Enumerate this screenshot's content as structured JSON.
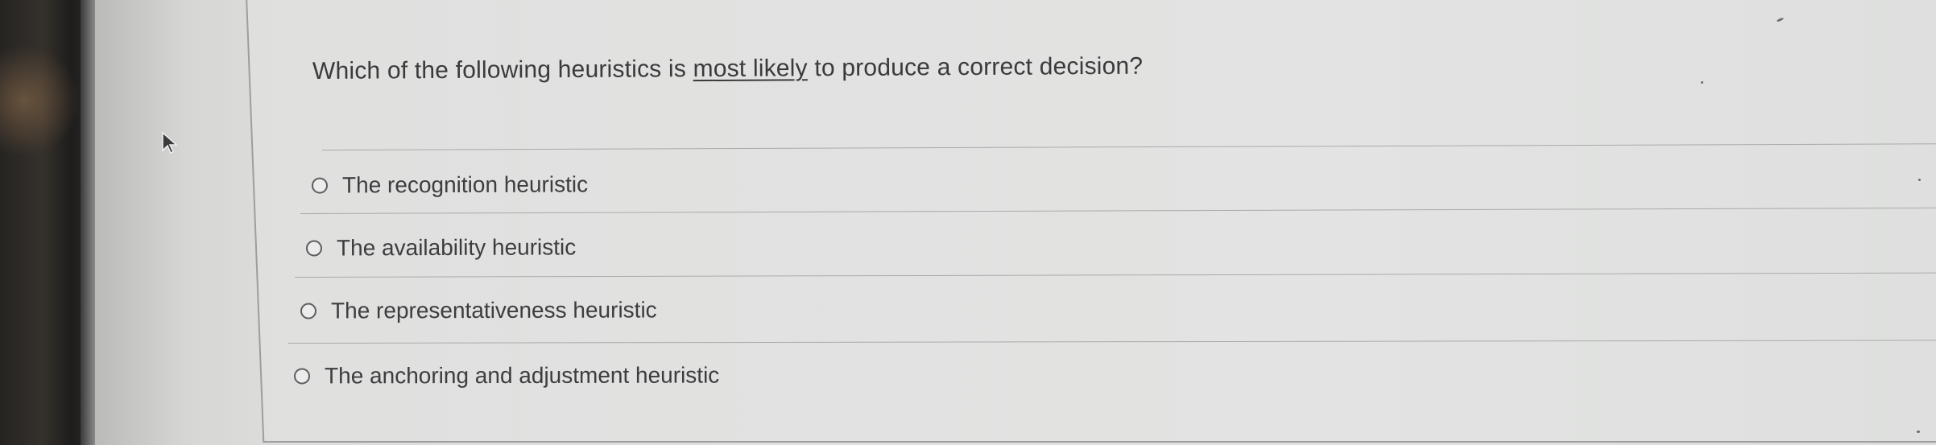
{
  "question": {
    "prefix": "Which of the following heuristics is ",
    "emphasis": "most likely",
    "suffix": " to produce a correct decision?"
  },
  "options": [
    {
      "label": "The recognition heuristic",
      "selected": false
    },
    {
      "label": "The availability heuristic",
      "selected": false
    },
    {
      "label": "The representativeness heuristic",
      "selected": false
    },
    {
      "label": "The anchoring and adjustment heuristic",
      "selected": false
    }
  ],
  "colors": {
    "screen_background": "#e0e1df",
    "text": "#3a3a3c",
    "divider": "#a9aaa9",
    "radio_border": "#5d5e60"
  },
  "icons": {
    "cursor": "mouse-pointer-icon",
    "radio": "radio-button-icon"
  }
}
